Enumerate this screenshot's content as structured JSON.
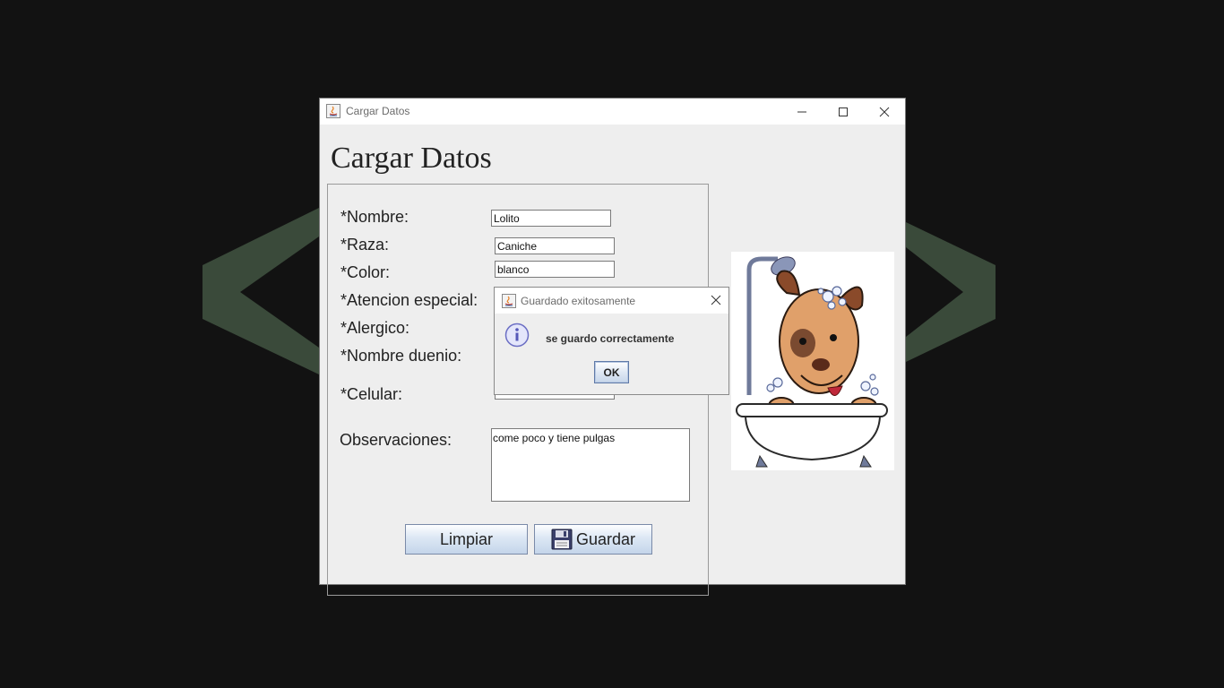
{
  "window": {
    "title": "Cargar Datos",
    "heading": "Cargar Datos",
    "controls": [
      "minimize-icon",
      "maximize-icon",
      "close-icon"
    ]
  },
  "form": {
    "fields": {
      "nombre": {
        "label": "*Nombre:",
        "value": "Lolito"
      },
      "raza": {
        "label": "*Raza:",
        "value": "Caniche"
      },
      "color": {
        "label": "*Color:",
        "value": "blanco"
      },
      "atencion": {
        "label": "*Atencion especial:",
        "value": ""
      },
      "alergico": {
        "label": "*Alergico:",
        "value": ""
      },
      "duenio": {
        "label": "*Nombre duenio:",
        "value": ""
      },
      "celular": {
        "label": "*Celular:",
        "value": ""
      },
      "observaciones": {
        "label": "Observaciones:",
        "value": "come poco y tiene pulgas"
      }
    },
    "buttons": {
      "limpiar": "Limpiar",
      "guardar": "Guardar"
    }
  },
  "dialog": {
    "title": "Guardado exitosamente",
    "message": "se guardo correctamente",
    "ok_label": "OK",
    "icon": "info-icon"
  },
  "colors": {
    "desktop_bg": "#121212",
    "chevron": "#3a4a3a",
    "window_bg": "#eeeeee",
    "button_gradient_top": "#fdfeff",
    "button_gradient_bottom": "#c4d5ea"
  },
  "image": {
    "description_icon": "dog-in-bathtub-illustration"
  }
}
